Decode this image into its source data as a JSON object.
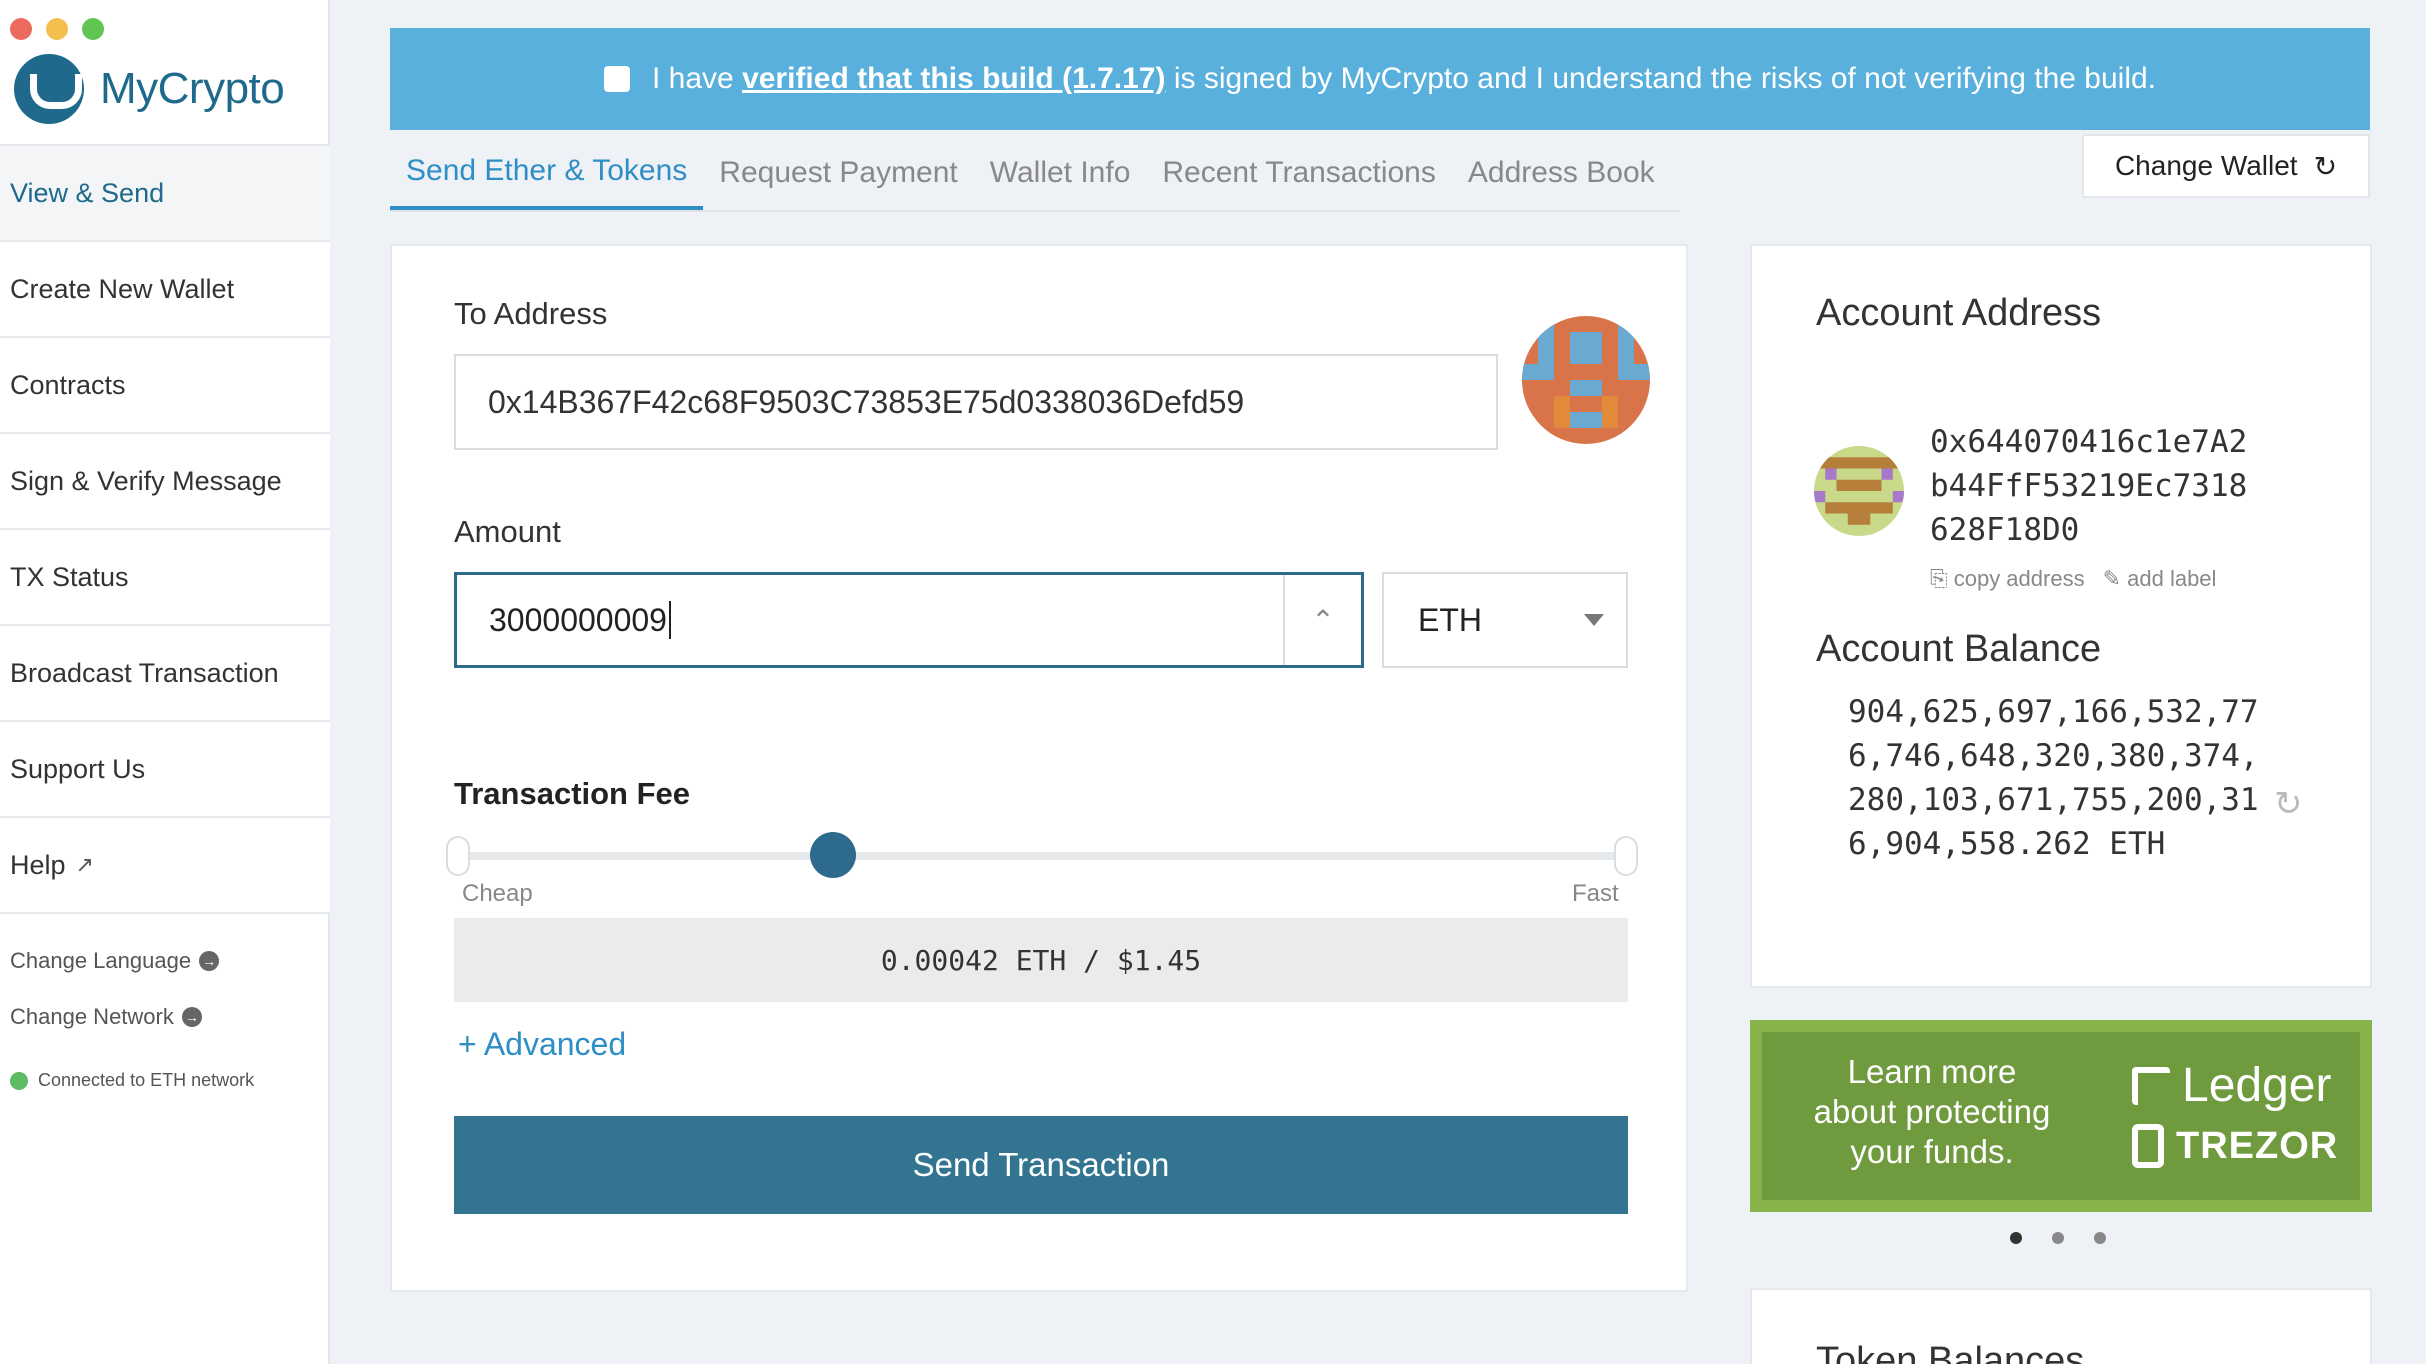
{
  "app": {
    "name": "MyCrypto"
  },
  "sidebar": {
    "items": [
      {
        "label": "View & Send",
        "active": true
      },
      {
        "label": "Create New Wallet"
      },
      {
        "label": "Contracts"
      },
      {
        "label": "Sign & Verify Message"
      },
      {
        "label": "TX Status"
      },
      {
        "label": "Broadcast Transaction"
      },
      {
        "label": "Support Us"
      },
      {
        "label": "Help"
      }
    ],
    "change_language": "Change Language",
    "change_network": "Change Network",
    "connection_status": "Connected to ETH network"
  },
  "banner": {
    "prefix": "I have",
    "link": "verified that this build (1.7.17)",
    "suffix": "is signed by MyCrypto and I understand the risks of not verifying the build."
  },
  "tabs": [
    {
      "label": "Send Ether & Tokens",
      "active": true
    },
    {
      "label": "Request Payment"
    },
    {
      "label": "Wallet Info"
    },
    {
      "label": "Recent Transactions"
    },
    {
      "label": "Address Book"
    }
  ],
  "change_wallet": "Change Wallet",
  "send_form": {
    "to_label": "To Address",
    "to_value": "0x14B367F42c68F9503C73853E75d0338036Defd59",
    "amount_label": "Amount",
    "amount_value": "3000000009",
    "unit": "ETH",
    "fee_label": "Transaction Fee",
    "fee_cheap": "Cheap",
    "fee_fast": "Fast",
    "fee_value": "0.00042 ETH / $1.45",
    "advanced": "+ Advanced",
    "send_button": "Send Transaction"
  },
  "account": {
    "title": "Account Address",
    "address_line1": "0x644070416c1e7A2",
    "address_line2": "b44FfF53219Ec7318",
    "address_line3": "628F18D0",
    "copy": "copy address",
    "add_label": "add label",
    "balance_title": "Account Balance",
    "balance": "904,625,697,166,532,776,746,648,320,380,374,280,103,671,755,200,316,904,558.262 ETH"
  },
  "promo": {
    "text": "Learn more about protecting your funds.",
    "ledger": "Ledger",
    "trezor": "TREZOR"
  },
  "token_balances": {
    "title": "Token Balances"
  },
  "colors": {
    "brand": "#1f6a8c",
    "banner": "#5ab0dc",
    "accent": "#2e8ec5",
    "button": "#337591",
    "promo": "#6f9a3e"
  }
}
